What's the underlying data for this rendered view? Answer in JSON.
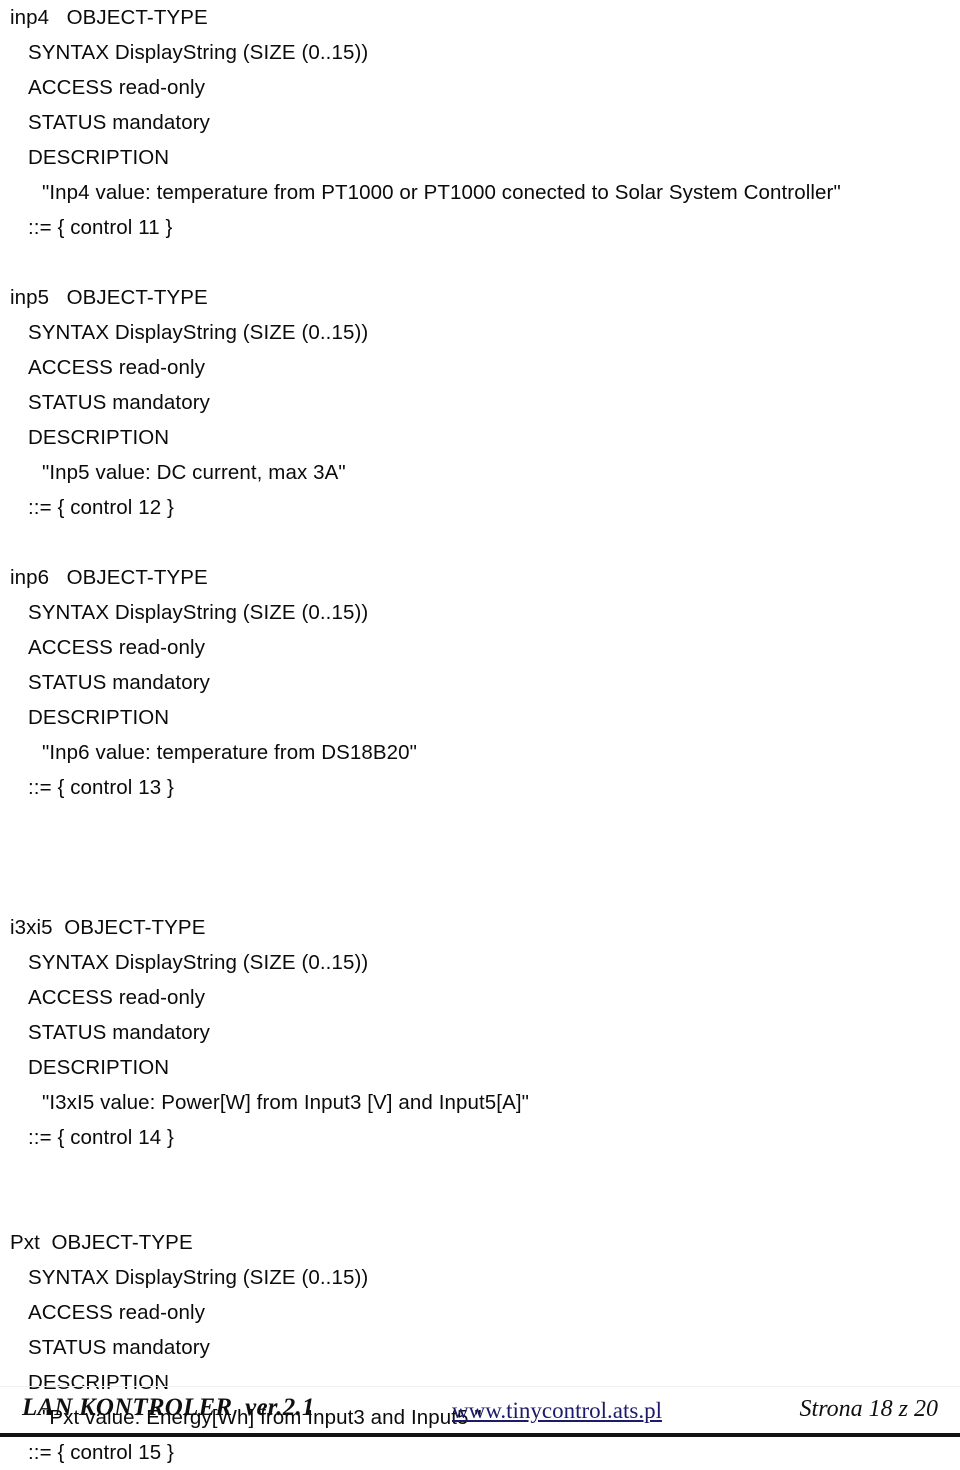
{
  "document": {
    "blocks": [
      {
        "name": "inp4",
        "keyword": "OBJECT-TYPE",
        "name_gap": "   ",
        "syntax": "SYNTAX DisplayString (SIZE (0..15))",
        "access": "ACCESS read-only",
        "status": "STATUS mandatory",
        "description_label": "DESCRIPTION",
        "description_value": "\"Inp4 value: temperature from PT1000 or PT1000 conected to Solar System Controller\"",
        "assignment": "::= { control 11 }"
      },
      {
        "name": "inp5",
        "keyword": "OBJECT-TYPE",
        "name_gap": "   ",
        "syntax": "SYNTAX DisplayString (SIZE (0..15))",
        "access": "ACCESS read-only",
        "status": "STATUS mandatory",
        "description_label": "DESCRIPTION",
        "description_value": "\"Inp5 value: DC current, max 3A\"",
        "assignment": "::= { control 12 }"
      },
      {
        "name": "inp6",
        "keyword": "OBJECT-TYPE",
        "name_gap": "   ",
        "syntax": "SYNTAX DisplayString (SIZE (0..15))",
        "access": "ACCESS read-only",
        "status": "STATUS mandatory",
        "description_label": "DESCRIPTION",
        "description_value": "\"Inp6 value: temperature from DS18B20\"",
        "assignment": "::= { control 13 }"
      },
      {
        "name": "i3xi5",
        "keyword": "OBJECT-TYPE",
        "name_gap": "  ",
        "syntax": "SYNTAX DisplayString (SIZE (0..15))",
        "access": "ACCESS read-only",
        "status": "STATUS mandatory",
        "description_label": "DESCRIPTION",
        "description_value": "\"I3xI5 value: Power[W] from Input3 [V] and Input5[A]\"",
        "assignment": "::= { control 14 }"
      },
      {
        "name": "Pxt",
        "keyword": "OBJECT-TYPE",
        "name_gap": "  ",
        "syntax": "SYNTAX DisplayString (SIZE (0..15))",
        "access": "ACCESS read-only",
        "status": "STATUS mandatory",
        "description_label": "DESCRIPTION",
        "description_value": "\"Pxt value: Energy[Wh] from Input3 and Input5 \"",
        "assignment": "::= { control 15 }"
      }
    ]
  },
  "footer": {
    "product": "LAN KONTROLER  ver.2.1",
    "url": "www.tinycontrol.ats.pl",
    "page_label": "Strona 18 z 20",
    "link_color": "#1b1b6b"
  }
}
